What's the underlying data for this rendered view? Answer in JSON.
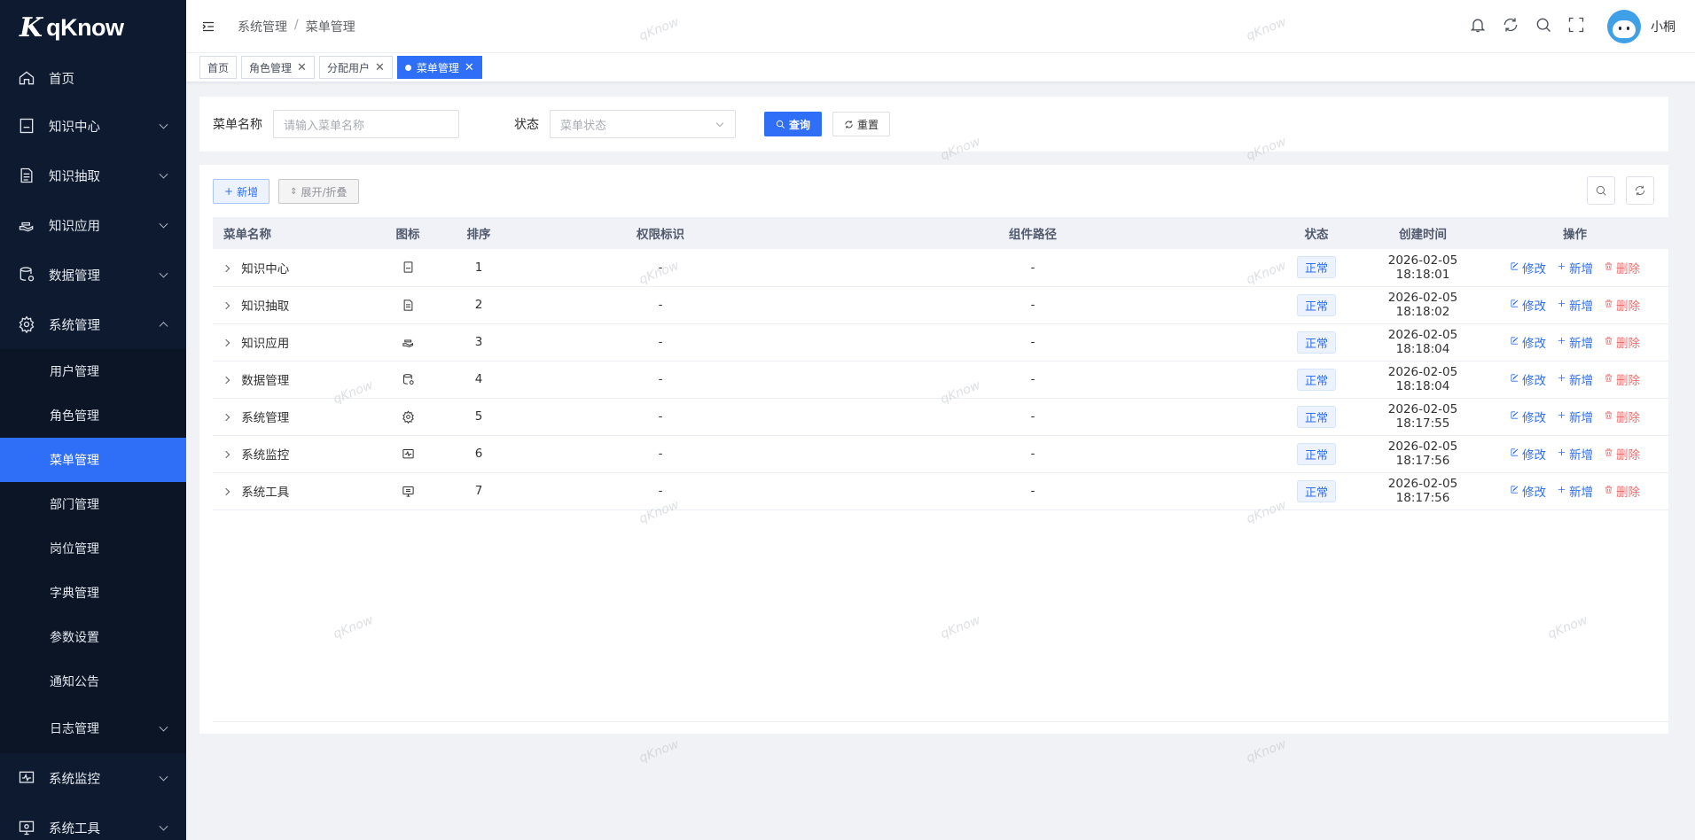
{
  "app": {
    "logo_mark": "K",
    "logo_text": "qKnow"
  },
  "sidebar": {
    "items": [
      {
        "label": "首页",
        "icon": "home-icon",
        "expandable": false
      },
      {
        "label": "知识中心",
        "icon": "book-icon",
        "expandable": true
      },
      {
        "label": "知识抽取",
        "icon": "document-icon",
        "expandable": true
      },
      {
        "label": "知识应用",
        "icon": "hand-icon",
        "expandable": true
      },
      {
        "label": "数据管理",
        "icon": "database-icon",
        "expandable": true
      },
      {
        "label": "系统管理",
        "icon": "gear-icon",
        "expandable": true,
        "expanded": true
      }
    ],
    "sub_items": [
      {
        "label": "用户管理"
      },
      {
        "label": "角色管理"
      },
      {
        "label": "菜单管理",
        "active": true
      },
      {
        "label": "部门管理"
      },
      {
        "label": "岗位管理"
      },
      {
        "label": "字典管理"
      },
      {
        "label": "参数设置"
      },
      {
        "label": "通知公告"
      },
      {
        "label": "日志管理",
        "expandable": true
      }
    ],
    "bottom_items": [
      {
        "label": "系统监控",
        "icon": "monitor-icon"
      },
      {
        "label": "系统工具",
        "icon": "tool-icon"
      }
    ]
  },
  "header": {
    "breadcrumb": [
      "系统管理",
      "菜单管理"
    ],
    "breadcrumb_sep": "/",
    "username": "小桐"
  },
  "tags": [
    {
      "label": "首页",
      "closable": false
    },
    {
      "label": "角色管理",
      "closable": true
    },
    {
      "label": "分配用户",
      "closable": true
    },
    {
      "label": "菜单管理",
      "closable": true,
      "active": true
    }
  ],
  "search": {
    "name_label": "菜单名称",
    "name_placeholder": "请输入菜单名称",
    "status_label": "状态",
    "status_placeholder": "菜单状态",
    "query_label": "查询",
    "reset_label": "重置"
  },
  "toolbar": {
    "add_label": "新增",
    "expand_label": "展开/折叠"
  },
  "table": {
    "columns": [
      "菜单名称",
      "图标",
      "排序",
      "权限标识",
      "组件路径",
      "状态",
      "创建时间",
      "操作"
    ],
    "rows": [
      {
        "name": "知识中心",
        "icon": "book-icon",
        "order": "1",
        "perms": "-",
        "component": "-",
        "status": "正常",
        "created": "2026-02-05 18:18:01"
      },
      {
        "name": "知识抽取",
        "icon": "document-icon",
        "order": "2",
        "perms": "-",
        "component": "-",
        "status": "正常",
        "created": "2026-02-05 18:18:02"
      },
      {
        "name": "知识应用",
        "icon": "hand-icon",
        "order": "3",
        "perms": "-",
        "component": "-",
        "status": "正常",
        "created": "2026-02-05 18:18:04"
      },
      {
        "name": "数据管理",
        "icon": "database-icon",
        "order": "4",
        "perms": "-",
        "component": "-",
        "status": "正常",
        "created": "2026-02-05 18:18:04"
      },
      {
        "name": "系统管理",
        "icon": "gear-icon",
        "order": "5",
        "perms": "-",
        "component": "-",
        "status": "正常",
        "created": "2026-02-05 18:17:55"
      },
      {
        "name": "系统监控",
        "icon": "monitor-icon",
        "order": "6",
        "perms": "-",
        "component": "-",
        "status": "正常",
        "created": "2026-02-05 18:17:56"
      },
      {
        "name": "系统工具",
        "icon": "tool-icon",
        "order": "7",
        "perms": "-",
        "component": "-",
        "status": "正常",
        "created": "2026-02-05 18:17:56"
      }
    ],
    "actions": {
      "edit": "修改",
      "add": "新增",
      "delete": "删除"
    }
  },
  "watermark": "qKnow",
  "colors": {
    "primary": "#2f6ef7",
    "sidebar_bg": "#0e1a2f",
    "danger": "#f56c6c"
  }
}
